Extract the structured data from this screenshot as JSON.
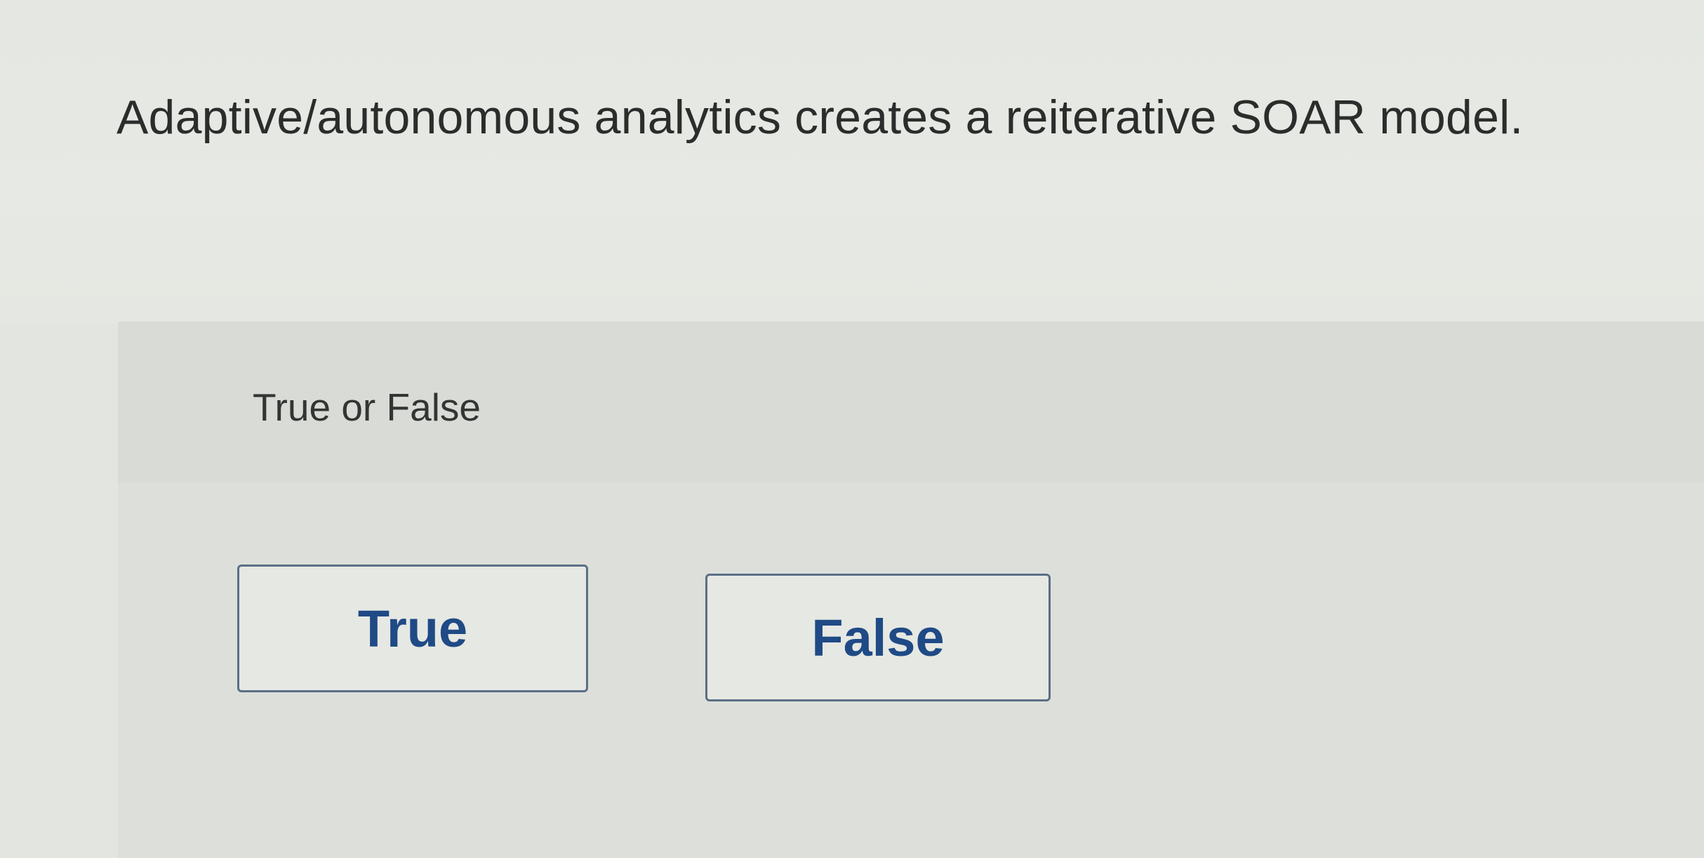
{
  "question": {
    "text": "Adaptive/autonomous analytics creates a reiterative SOAR model."
  },
  "answer": {
    "prompt": "True or False",
    "choices": [
      {
        "label": "True"
      },
      {
        "label": "False"
      }
    ]
  },
  "colors": {
    "button_text": "#1f4a86",
    "button_border": "#5a6f86",
    "background": "#e3e5e0"
  }
}
